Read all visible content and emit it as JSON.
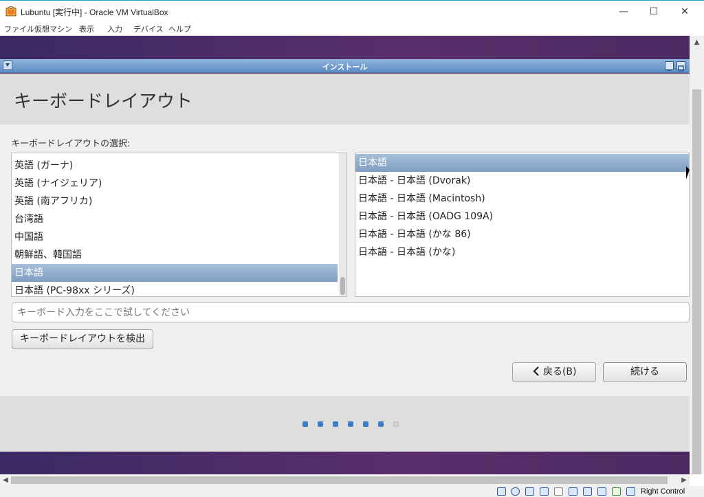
{
  "host_window": {
    "title": "Lubuntu [実行中] - Oracle VM VirtualBox",
    "minimize": "—",
    "maximize": "☐",
    "close": "✕",
    "menu": [
      "ファイル",
      "仮想マシン",
      "表示",
      "入力",
      "デバイス",
      "ヘルプ"
    ]
  },
  "installer": {
    "window_title": "インストール",
    "heading": "キーボードレイアウト",
    "select_label": "キーボードレイアウトの選択:",
    "layouts": [
      "英語 (ガーナ)",
      "英語 (ナイジェリア)",
      "英語 (南アフリカ)",
      "台湾語",
      "中国語",
      "朝鮮語、韓国語",
      "日本語",
      "日本語 (PC-98xx シリーズ)"
    ],
    "selected_layout_index": 6,
    "variants": [
      "日本語",
      "日本語 - 日本語 (Dvorak)",
      "日本語 - 日本語 (Macintosh)",
      "日本語 - 日本語 (OADG 109A)",
      "日本語 - 日本語 (かな 86)",
      "日本語 - 日本語 (かな)"
    ],
    "selected_variant_index": 0,
    "test_placeholder": "キーボード入力をここで試してください",
    "detect_button": "キーボードレイアウトを検出",
    "back_button": "戻る(B)",
    "continue_button": "続ける",
    "progress": {
      "total_steps": 7,
      "completed_steps": 6
    }
  },
  "statusbar": {
    "host_key": "Right Control"
  },
  "colors": {
    "selection": "#8ea9c9",
    "titlebar": "#6a97cc",
    "vm_background": "#4b2a62",
    "progress_dot": "#3d7fc4"
  }
}
